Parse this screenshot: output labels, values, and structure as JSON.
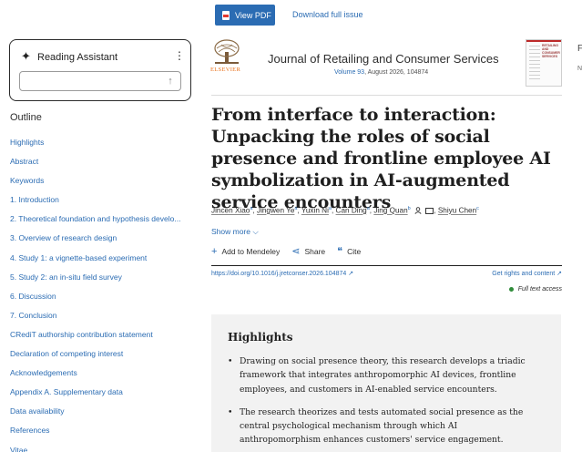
{
  "topbar": {
    "view_pdf_label": "View PDF",
    "download_label": "Download full issue"
  },
  "assistant": {
    "title": "Reading Assistant",
    "input_placeholder": ""
  },
  "outline": {
    "title": "Outline",
    "items": [
      "Highlights",
      "Abstract",
      "Keywords",
      "1. Introduction",
      "2. Theoretical foundation and hypothesis develo...",
      "3. Overview of research design",
      "4. Study 1: a vignette-based experiment",
      "5. Study 2: an in-situ field survey",
      "6. Discussion",
      "7. Conclusion",
      "CRediT authorship contribution statement",
      "Declaration of competing interest",
      "Acknowledgements",
      "Appendix A. Supplementary data",
      "Data availability",
      "References",
      "Vitae"
    ]
  },
  "journal": {
    "publisher": "ELSEVIER",
    "name": "Journal of Retailing and Consumer Services",
    "volume": "Volume 93",
    "issue_info": ", August 2026, 104874",
    "cover_text": "RETAILING AND CONSUMER SERVICES",
    "edge_letter_1": "F",
    "edge_letter_2": "N"
  },
  "article": {
    "title": "From interface to interaction: Unpacking the roles of social presence and frontline employee AI symbolization in AI-augmented service encounters",
    "authors": [
      {
        "name": "Jincen Xiao",
        "sup": "a"
      },
      {
        "name": "Jingwen Ye",
        "sup": "a"
      },
      {
        "name": "Yuxin Ni",
        "sup": "a"
      },
      {
        "name": "Can Ding",
        "sup": "a"
      },
      {
        "name": "Jing Quan",
        "sup": "b"
      },
      {
        "name": "Shiyu Chen",
        "sup": "c"
      }
    ],
    "show_more": "Show more",
    "actions": {
      "mendeley": "Add to Mendeley",
      "share": "Share",
      "cite": "Cite"
    },
    "doi": "https://doi.org/10.1016/j.jretconser.2026.104874",
    "rights": "Get rights and content",
    "access": "Full text access"
  },
  "highlights": {
    "title": "Highlights",
    "items": [
      "Drawing on social presence theory, this research develops a triadic framework that integrates anthropomorphic AI devices, frontline employees, and customers in AI-enabled service encounters.",
      "The research theorizes and tests automated social presence as the central psychological mechanism through which AI anthropomorphism enhances customers' service engagement."
    ]
  },
  "colors": {
    "link": "#2b6cb3",
    "button": "#2b6cb3",
    "access_dot": "#2f8c3a",
    "publisher_orange": "#e9711c"
  }
}
